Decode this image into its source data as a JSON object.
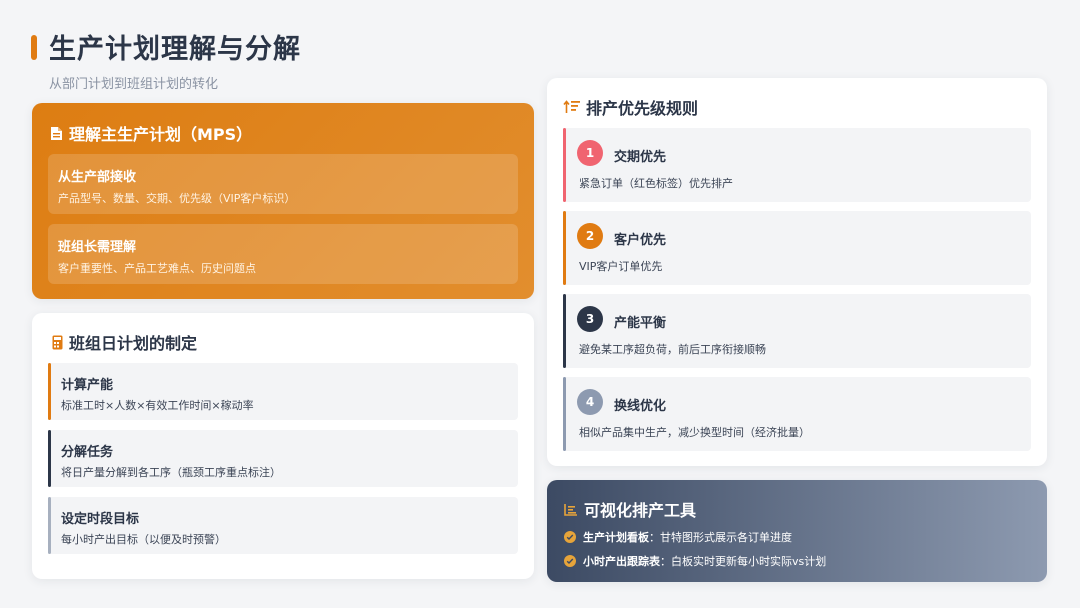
{
  "header": {
    "title": "生产计划理解与分解",
    "subtitle": "从部门计划到班组计划的转化"
  },
  "mps": {
    "title": "理解主生产计划（MPS）",
    "icon": "document-icon",
    "blocks": [
      {
        "title": "从生产部接收",
        "desc": "产品型号、数量、交期、优先级（VIP客户标识）"
      },
      {
        "title": "班组长需理解",
        "desc": "客户重要性、产品工艺难点、历史问题点"
      }
    ]
  },
  "daily": {
    "title": "班组日计划的制定",
    "icon": "calculator-icon",
    "items": [
      {
        "title": "计算产能",
        "desc": "标准工时×人数×有效工作时间×稼动率",
        "color": "#e07b12"
      },
      {
        "title": "分解任务",
        "desc": "将日产量分解到各工序（瓶颈工序重点标注）",
        "color": "#2c3648"
      },
      {
        "title": "设定时段目标",
        "desc": "每小时产出目标（以便及时预警）",
        "color": "#a7b0bf"
      }
    ]
  },
  "priority": {
    "title": "排产优先级规则",
    "icon": "sort-amount-icon",
    "items": [
      {
        "num": "1",
        "title": "交期优先",
        "desc": "紧急订单（红色标签）优先排产",
        "color": "#f06470"
      },
      {
        "num": "2",
        "title": "客户优先",
        "desc": "VIP客户订单优先",
        "color": "#e07b12"
      },
      {
        "num": "3",
        "title": "产能平衡",
        "desc": "避免某工序超负荷，前后工序衔接顺畅",
        "color": "#2c3648"
      },
      {
        "num": "4",
        "title": "换线优化",
        "desc": "相似产品集中生产，减少换型时间（经济批量）",
        "color": "#8d9ab0"
      }
    ]
  },
  "tools": {
    "title": "可视化排产工具",
    "icon": "chart-icon",
    "lines": [
      {
        "label": "生产计划看板",
        "sep": "：",
        "text": "甘特图形式展示各订单进度"
      },
      {
        "label": "小时产出跟踪表",
        "sep": "：",
        "text": "白板实时更新每小时实际vs计划"
      }
    ]
  }
}
